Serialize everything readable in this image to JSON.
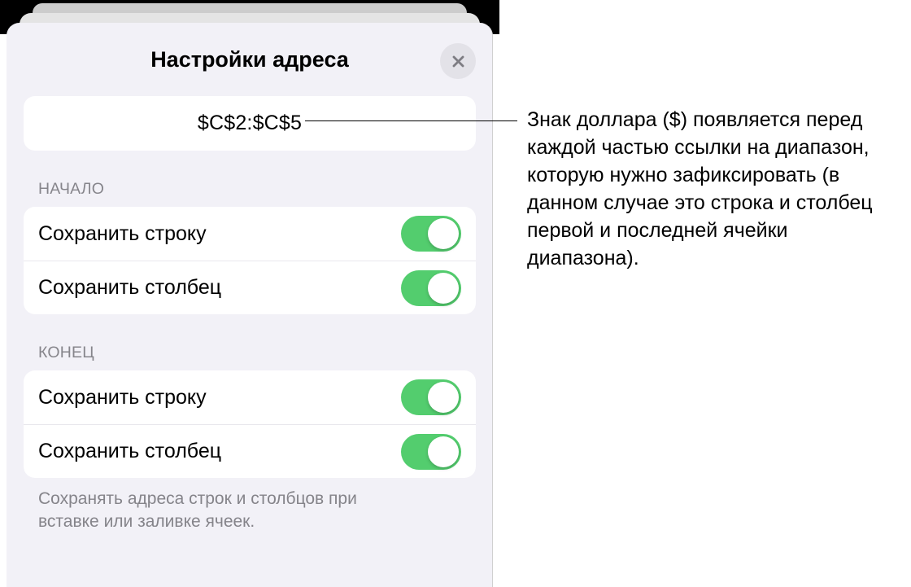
{
  "dialog": {
    "title": "Настройки адреса",
    "address_value": "$C$2:$C$5",
    "sections": {
      "start": {
        "label": "НАЧАЛО",
        "items": [
          {
            "label": "Сохранить строку",
            "on": true
          },
          {
            "label": "Сохранить столбец",
            "on": true
          }
        ]
      },
      "end": {
        "label": "КОНЕЦ",
        "items": [
          {
            "label": "Сохранить строку",
            "on": true
          },
          {
            "label": "Сохранить столбец",
            "on": true
          }
        ]
      }
    },
    "footer": "Сохранять адреса строк и столбцов при вставке или заливке ячеек."
  },
  "callout": {
    "text": "Знак доллара ($) появляется перед каждой частью ссылки на диапазон, которую нужно зафиксировать (в данном случае это строка и столбец первой и последней ячейки диапазона)."
  }
}
